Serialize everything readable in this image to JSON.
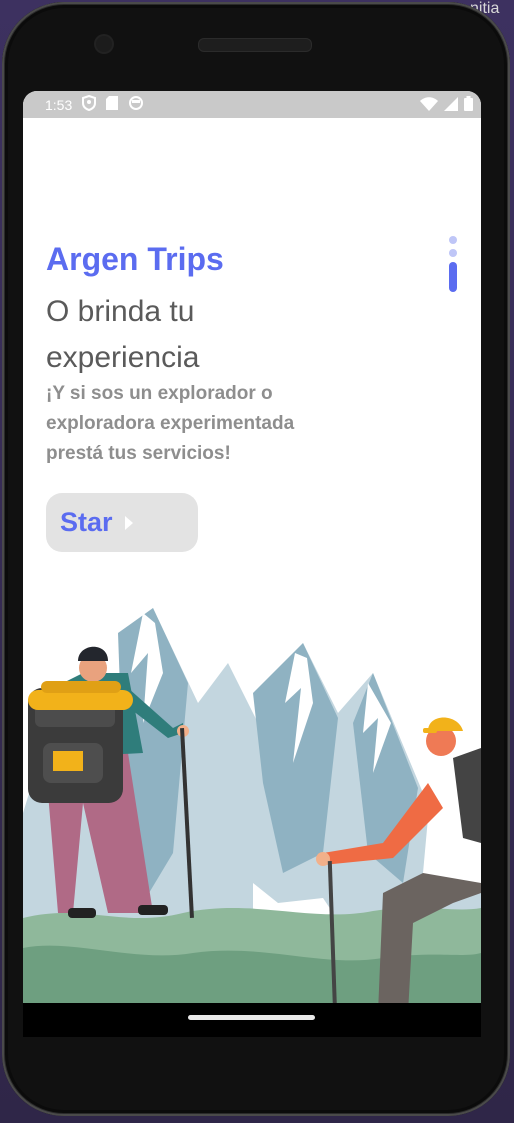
{
  "status_bar": {
    "time": "1:53",
    "icons": [
      "shield-icon",
      "sd-card-icon",
      "face-icon"
    ],
    "right_icons": [
      "wifi-icon",
      "signal-icon",
      "battery-icon"
    ]
  },
  "onboarding": {
    "title": "Argen Trips",
    "subtitle": "O brinda tu experiencia",
    "description": "¡Y si sos un explorador o exploradora experimentada prestá tus servicios!",
    "start_label": "Star",
    "page_count": 3,
    "current_page": 3
  },
  "colors": {
    "accent": "#5b6cf0",
    "subtitle": "#5a5a5a",
    "description": "#8e8e8e",
    "button_bg": "#e3e3e3"
  },
  "background_text": "nitia"
}
